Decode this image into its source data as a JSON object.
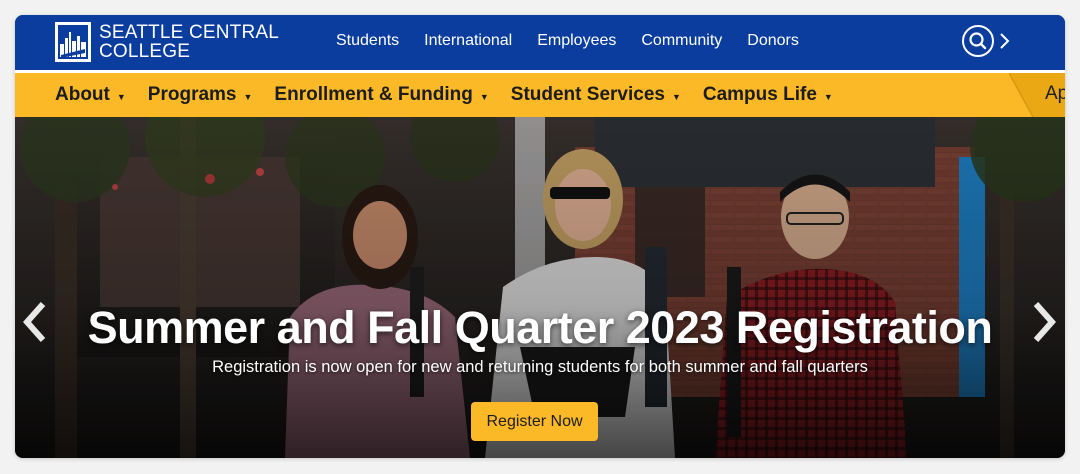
{
  "logo": {
    "line1": "SEATTLE CENTRAL",
    "line2": "COLLEGE"
  },
  "topnav": [
    "Students",
    "International",
    "Employees",
    "Community",
    "Donors"
  ],
  "search": {
    "icon": "search-icon",
    "chevron": "chevron-right-icon"
  },
  "menu": [
    {
      "label": "About"
    },
    {
      "label": "Programs"
    },
    {
      "label": "Enrollment & Funding"
    },
    {
      "label": "Student Services"
    },
    {
      "label": "Campus Life"
    }
  ],
  "apply_tab": "Ap",
  "hero": {
    "title": "Summer and Fall Quarter 2023 Registration",
    "subtitle": "Registration is now open for new and returning students for both summer and fall quarters",
    "cta": "Register Now",
    "prev_icon": "chevron-left-icon",
    "next_icon": "chevron-right-icon"
  },
  "colors": {
    "brand_blue": "#0b3d9e",
    "brand_yellow": "#fbb928"
  }
}
